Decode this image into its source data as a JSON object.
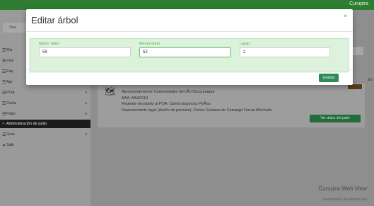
{
  "app": {
    "brand": "Curupira"
  },
  "sidebar": {
    "search_label": "Sea",
    "items": [
      {
        "label": "Mis",
        "icon": "menu-icon",
        "has_chevron": false
      },
      {
        "label": "Vive",
        "icon": "menu-icon",
        "has_chevron": false
      },
      {
        "label": "Esp",
        "icon": "menu-icon",
        "has_chevron": false
      },
      {
        "label": "Apr",
        "icon": "menu-icon",
        "has_chevron": false
      },
      {
        "label": "POA",
        "icon": "menu-icon",
        "has_chevron": true
      },
      {
        "label": "Corta",
        "icon": "menu-icon",
        "has_chevron": true
      },
      {
        "label": "Patio",
        "icon": "menu-icon",
        "has_chevron": true
      },
      {
        "label": "Administración de patio",
        "icon": "circle-icon",
        "has_chevron": false,
        "active": true
      },
      {
        "label": "Guia",
        "icon": "menu-icon",
        "has_chevron": true
      },
      {
        "label": "Salir",
        "icon": "logout-icon",
        "has_chevron": false
      }
    ]
  },
  "card": {
    "lines": [
      "Aprovechamiento: Comunidades del rÃo Chucunaque",
      "AAA: AAA2010",
      "Regente vinculado al POA: Carlos Espinosa PeÃ±a",
      "Representante legal (dueño de permiso): Carlos Gustavo de Camargo Ferraz Machado"
    ],
    "button_label": "Ver datos del patio",
    "side_num": "ao"
  },
  "footer": {
    "title": "Curupira Web View",
    "subtitle": "Desarrollado por AnimaeTag"
  },
  "modal": {
    "title": "Editar árbol",
    "close": "×",
    "fields": {
      "mayor": {
        "label": "Mayor diam.",
        "value": "58"
      },
      "menor": {
        "label": "Menor diam.",
        "value": "52"
      },
      "largo": {
        "label": "Largo",
        "value": "2"
      }
    },
    "save_label": "Grabar"
  },
  "colors": {
    "accent": "#4caf50",
    "primary_button": "#2e8b57",
    "topbar": "#2e7d32"
  }
}
